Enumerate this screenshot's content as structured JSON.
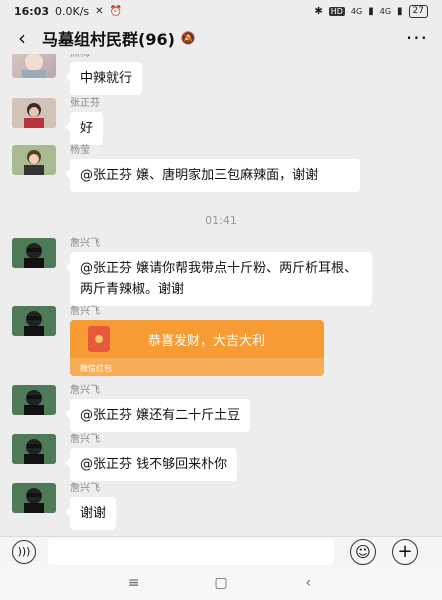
{
  "status": {
    "time": "16:03",
    "speed": "0.0K/s",
    "hd": "HD",
    "signal1": "4G",
    "signal2": "4G",
    "battery": "27"
  },
  "header": {
    "back_icon": "chevron-left-icon",
    "title": "马墓组村民群(96)",
    "mute_icon": "bell-off-icon",
    "more_icon": "more-dots-icon"
  },
  "messages": [
    {
      "sender": "熊梅",
      "text": "中辣就行"
    },
    {
      "sender": "张正芬",
      "text": "好"
    },
    {
      "sender": "杨莹",
      "text": "@张正芬  嬢、唐明家加三包麻辣面，谢谢"
    },
    {
      "sender": "詹兴飞",
      "text": "@张正芬  嬢请你帮我带点十斤粉、两斤析耳根、两斤青辣椒。谢谢"
    },
    {
      "sender": "詹兴飞",
      "text": "恭喜发财，大吉大利",
      "label": "微信红包"
    },
    {
      "sender": "詹兴飞",
      "text": "@张正芬  嬢还有二十斤土豆"
    },
    {
      "sender": "詹兴飞",
      "text": "@张正芬  钱不够回来朴你"
    },
    {
      "sender": "詹兴飞",
      "text": "谢谢"
    }
  ],
  "timestamp": "01:41",
  "input": {
    "voice_icon": "voice-icon",
    "emoji_icon": "emoji-icon",
    "plus_icon": "plus-icon"
  },
  "nav": {
    "menu_icon": "menu-icon",
    "home_icon": "home-icon",
    "back_icon": "back-icon"
  },
  "colors": {
    "background": "#ededed",
    "bubble": "#ffffff",
    "red_packet": "#f79c35"
  }
}
